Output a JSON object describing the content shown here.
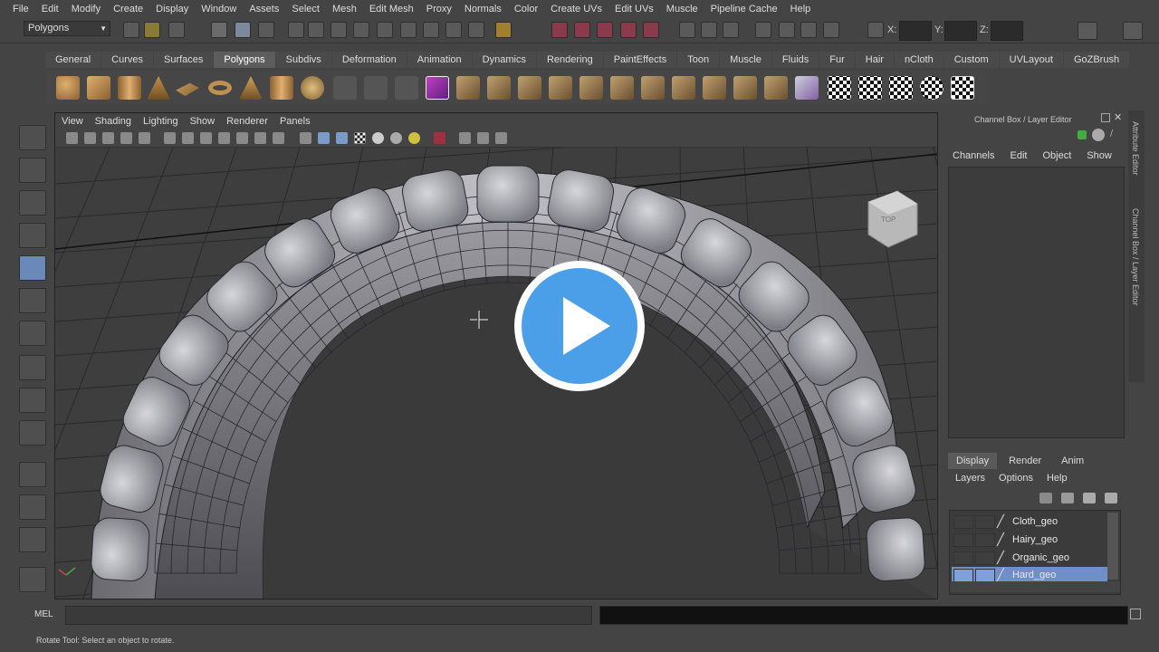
{
  "menubar": [
    "File",
    "Edit",
    "Modify",
    "Create",
    "Display",
    "Window",
    "Assets",
    "Select",
    "Mesh",
    "Edit Mesh",
    "Proxy",
    "Normals",
    "Color",
    "Create UVs",
    "Edit UVs",
    "Muscle",
    "Pipeline Cache",
    "Help"
  ],
  "statusline": {
    "mode": "Polygons",
    "x_label": "X:",
    "y_label": "Y:",
    "z_label": "Z:"
  },
  "shelf_tabs": [
    "General",
    "Curves",
    "Surfaces",
    "Polygons",
    "Subdivs",
    "Deformation",
    "Animation",
    "Dynamics",
    "Rendering",
    "PaintEffects",
    "Toon",
    "Muscle",
    "Fluids",
    "Fur",
    "Hair",
    "nCloth",
    "Custom",
    "UVLayout",
    "GoZBrush"
  ],
  "active_shelf_tab": "Polygons",
  "panel_menu": [
    "View",
    "Shading",
    "Lighting",
    "Show",
    "Renderer",
    "Panels"
  ],
  "viewcube_label": "TOP",
  "channel_box": {
    "title": "Channel Box / Layer Editor",
    "menu": [
      "Channels",
      "Edit",
      "Object",
      "Show"
    ]
  },
  "side_tabs": {
    "attribute_editor": "Attribute Editor",
    "channel_box": "Channel Box / Layer Editor"
  },
  "layer_editor": {
    "tabs": [
      "Display",
      "Render",
      "Anim"
    ],
    "active_tab": "Display",
    "menu": [
      "Layers",
      "Options",
      "Help"
    ],
    "layers": [
      {
        "name": "Cloth_geo",
        "selected": false
      },
      {
        "name": "Hairy_geo",
        "selected": false
      },
      {
        "name": "Organic_geo",
        "selected": false
      },
      {
        "name": "Hard_geo",
        "selected": true
      }
    ]
  },
  "command_line": {
    "label": "MEL"
  },
  "help_line": "Rotate Tool: Select an object to rotate.",
  "colors": {
    "play_button": "#4a9fe8",
    "selection": "#6f8fc8",
    "mesh": "#b8b8bc"
  }
}
